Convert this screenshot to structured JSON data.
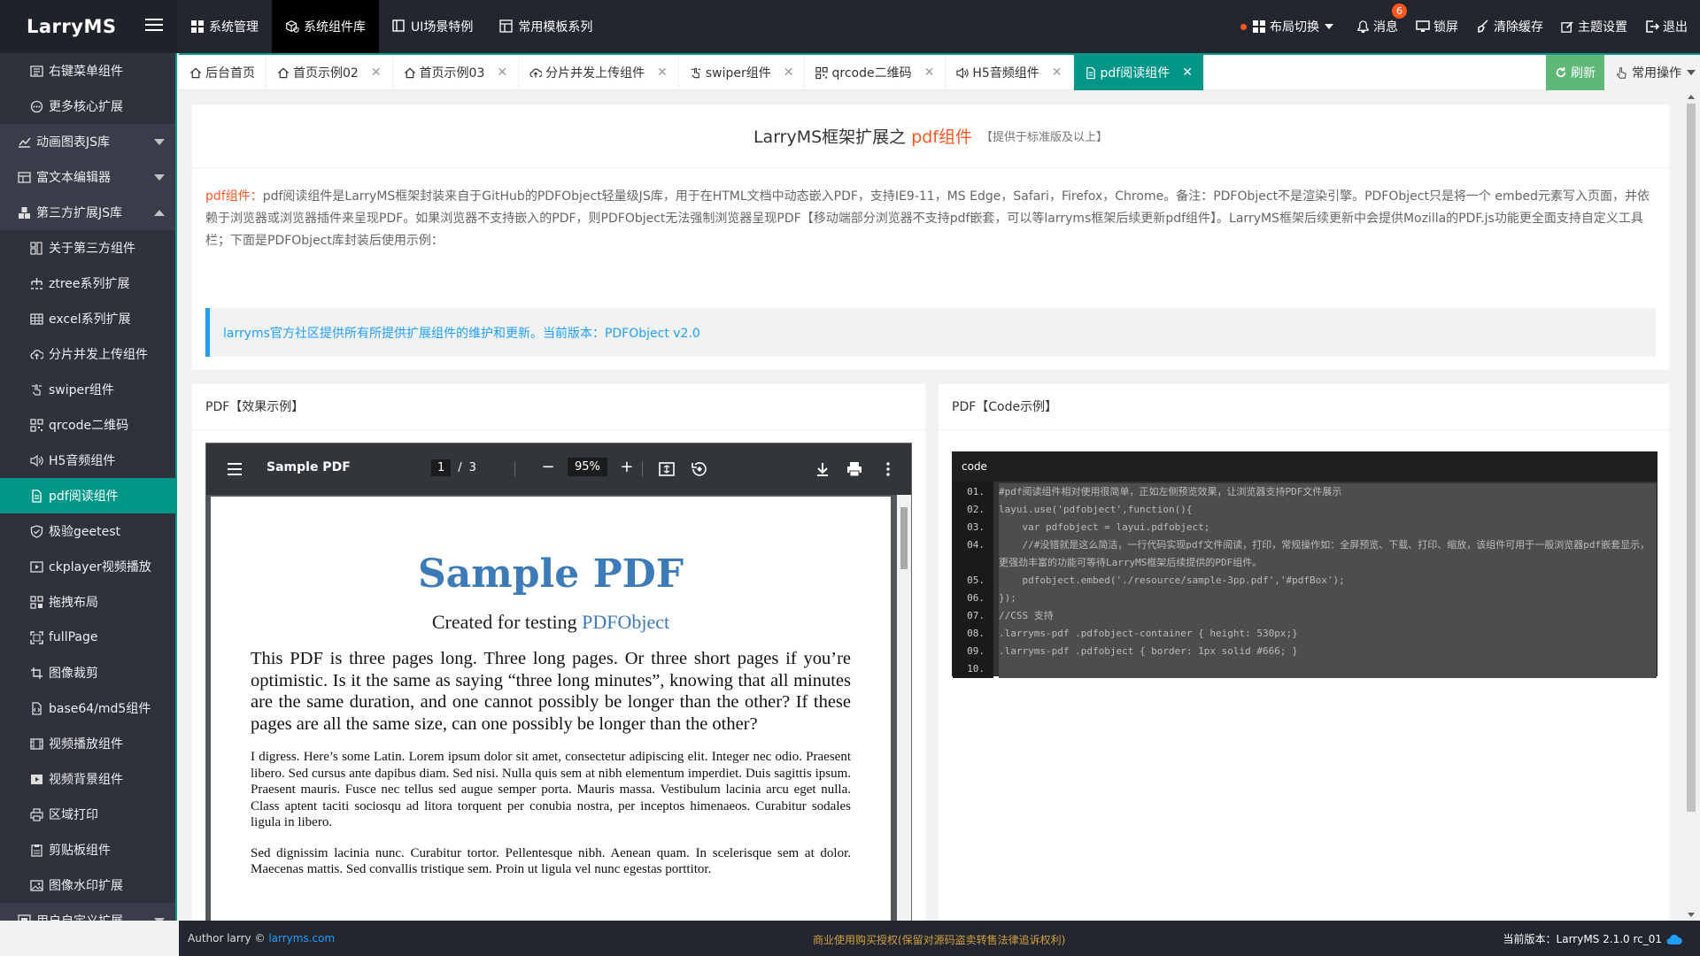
{
  "app": {
    "logo": "LarryMS"
  },
  "topnav": [
    {
      "label": "系统管理",
      "icon": "grid-icon"
    },
    {
      "label": "系统组件库",
      "icon": "cube-icon",
      "active": true
    },
    {
      "label": "UI场景特例",
      "icon": "window-icon"
    },
    {
      "label": "常用模板系列",
      "icon": "template-icon"
    }
  ],
  "topright": {
    "layout": "布局切换",
    "message": "消息",
    "message_badge": "6",
    "lock": "锁屏",
    "clear_cache": "清除缓存",
    "theme": "主题设置",
    "logout": "退出"
  },
  "sidebar": [
    {
      "label": "右键菜单组件",
      "type": "sub",
      "icon": "menu-icon"
    },
    {
      "label": "更多核心扩展",
      "type": "sub",
      "icon": "more-icon"
    },
    {
      "label": "动画图表JS库",
      "type": "group",
      "icon": "chart-icon",
      "caret": "down"
    },
    {
      "label": "富文本编辑器",
      "type": "group",
      "icon": "editor-icon",
      "caret": "down"
    },
    {
      "label": "第三方扩展JS库",
      "type": "group",
      "icon": "cubes-icon",
      "caret": "up"
    },
    {
      "label": "关于第三方组件",
      "type": "sub",
      "icon": "info-icon"
    },
    {
      "label": "ztree系列扩展",
      "type": "sub",
      "icon": "tree-icon"
    },
    {
      "label": "excel系列扩展",
      "type": "sub",
      "icon": "table-icon"
    },
    {
      "label": "分片并发上传组件",
      "type": "sub",
      "icon": "upload-cloud-icon"
    },
    {
      "label": "swiper组件",
      "type": "sub",
      "icon": "swipe-icon"
    },
    {
      "label": "qrcode二维码",
      "type": "sub",
      "icon": "qrcode-icon"
    },
    {
      "label": "H5音频组件",
      "type": "sub",
      "icon": "volume-icon"
    },
    {
      "label": "pdf阅读组件",
      "type": "sub",
      "icon": "file-icon",
      "active": true
    },
    {
      "label": "极验geetest",
      "type": "sub",
      "icon": "shield-check-icon"
    },
    {
      "label": "ckplayer视频播放",
      "type": "sub",
      "icon": "video-icon"
    },
    {
      "label": "拖拽布局",
      "type": "sub",
      "icon": "drag-icon"
    },
    {
      "label": "fullPage",
      "type": "sub",
      "icon": "fullscreen-icon"
    },
    {
      "label": "图像裁剪",
      "type": "sub",
      "icon": "crop-icon"
    },
    {
      "label": "base64/md5组件",
      "type": "sub",
      "icon": "code-file-icon"
    },
    {
      "label": "视频播放组件",
      "type": "sub",
      "icon": "film-icon"
    },
    {
      "label": "视频背景组件",
      "type": "sub",
      "icon": "play-icon"
    },
    {
      "label": "区域打印",
      "type": "sub",
      "icon": "print-icon"
    },
    {
      "label": "剪贴板组件",
      "type": "sub",
      "icon": "clipboard-icon"
    },
    {
      "label": "图像水印扩展",
      "type": "sub",
      "icon": "image-icon"
    },
    {
      "label": "用户自定义扩展",
      "type": "group",
      "icon": "custom-icon",
      "caret": "down"
    }
  ],
  "tabs": [
    {
      "label": "后台首页",
      "icon": "home-icon",
      "closable": false
    },
    {
      "label": "首页示例02",
      "icon": "home-icon",
      "closable": true
    },
    {
      "label": "首页示例03",
      "icon": "home-icon",
      "closable": true
    },
    {
      "label": "分片并发上传组件",
      "icon": "upload-cloud-icon",
      "closable": true
    },
    {
      "label": "swiper组件",
      "icon": "swipe-icon",
      "closable": true
    },
    {
      "label": "qrcode二维码",
      "icon": "qrcode-icon",
      "closable": true
    },
    {
      "label": "H5音频组件",
      "icon": "volume-icon",
      "closable": true
    },
    {
      "label": "pdf阅读组件",
      "icon": "file-icon",
      "closable": true,
      "active": true
    }
  ],
  "tab_actions": {
    "refresh": "刷新",
    "ops": "常用操作"
  },
  "intro": {
    "title_prefix": "LarryMS框架扩展之",
    "title_highlight": "pdf组件",
    "title_note": "【提供于标准版及以上】",
    "desc_label": "pdf组件：",
    "desc_text": "pdf阅读组件是LarryMS框架封装来自于GitHub的PDFObject轻量级JS库，用于在HTML文档中动态嵌入PDF，支持IE9-11，MS Edge，Safari，Firefox，Chrome。备注：PDFObject不是渲染引擎。PDFObject只是将一个 embed元素写入页面，并依赖于浏览器或浏览器插件来呈现PDF。如果浏览器不支持嵌入的PDF，则PDFObject无法强制浏览器呈现PDF【移动端部分浏览器不支持pdf嵌套，可以等larryms框架后续更新pdf组件】。LarryMS框架后续更新中会提供Mozilla的PDF.js功能更全面支持自定义工具栏；下面是PDFObject库封装后使用示例：",
    "notice": "larryms官方社区提供所有所提供扩展组件的维护和更新。当前版本：PDFObject v2.0"
  },
  "left_card": {
    "title": "PDF【效果示例】",
    "viewer": {
      "doc_name": "Sample PDF",
      "page_current": "1",
      "page_sep": "/",
      "page_total": "3",
      "zoom": "95%",
      "zoom_out": "−",
      "zoom_in": "+"
    },
    "pdf": {
      "h1": "Sample PDF",
      "sub_prefix": "Created for testing",
      "sub_link": "PDFObject",
      "p1": "This PDF is three pages long. Three long pages. Or three short pages if you’re optimistic. Is it the same as saying “three long minutes”, knowing that all minutes are the same duration, and one cannot possibly be longer than the other? If these pages are all the same size, can one possibly be longer than the other?",
      "p2": "I digress. Here’s some Latin. Lorem ipsum dolor sit amet, consectetur adipiscing elit. Integer nec odio. Praesent libero. Sed cursus ante dapibus diam. Sed nisi. Nulla quis sem at nibh elementum imperdiet. Duis sagittis ipsum. Praesent mauris. Fusce nec tellus sed augue semper porta. Mauris massa. Vestibulum lacinia arcu eget nulla. Class aptent taciti sociosqu ad litora torquent per conubia nostra, per inceptos himenaeos. Curabitur sodales ligula in libero.",
      "p3": "Sed dignissim lacinia nunc. Curabitur tortor. Pellentesque nibh. Aenean quam. In scelerisque sem at dolor. Maecenas mattis. Sed convallis tristique sem. Proin ut ligula vel nunc egestas porttitor."
    }
  },
  "right_card": {
    "title": "PDF【Code示例】",
    "code_label": "code",
    "lines": [
      {
        "n": "01.",
        "t": "#pdf阅读组件相对使用很简单，正如左侧预览效果，让浏览器支持PDF文件展示"
      },
      {
        "n": "02.",
        "t": "layui.use('pdfobject',function(){"
      },
      {
        "n": "03.",
        "t": "    var pdfobject = layui.pdfobject;"
      },
      {
        "n": "04.",
        "t": "    //#没错就是这么简洁，一行代码实现pdf文件阅读，打印，常规操作如：全屏预览、下载、打印、缩放，该组件可用于一般浏览器pdf嵌套显示，更强劲丰富的功能可等待LarryMS框架后续提供的PDF组件。"
      },
      {
        "n": "05.",
        "t": "    pdfobject.embed('./resource/sample-3pp.pdf','#pdfBox');"
      },
      {
        "n": "06.",
        "t": "});"
      },
      {
        "n": "07.",
        "t": "//CSS 支持"
      },
      {
        "n": "08.",
        "t": ".larryms-pdf .pdfobject-container { height: 530px;}"
      },
      {
        "n": "09.",
        "t": ".larryms-pdf .pdfobject { border: 1px solid #666; }"
      },
      {
        "n": "10.",
        "t": ""
      }
    ]
  },
  "footer": {
    "author": "Author larry ©",
    "author_link": "larryms.com",
    "center": "商业使用购买授权(保留对源码盗卖转售法律追诉权利)",
    "version": "当前版本：LarryMS 2.1.0 rc_01"
  },
  "colors": {
    "accent": "#009688",
    "orange": "#ff5722",
    "blue": "#1e9fff",
    "dark": "#23262e",
    "sidebar": "#393d49"
  }
}
